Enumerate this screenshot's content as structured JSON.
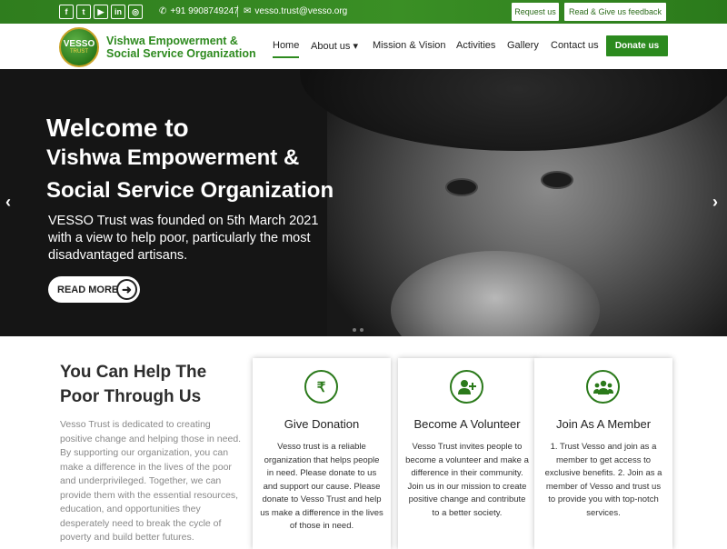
{
  "topbar": {
    "social": [
      "f",
      "t",
      "▶",
      "in",
      "◎"
    ],
    "phone": "+91 9908749247",
    "email": "vesso.trust@vesso.org",
    "request_label": "Request us",
    "feedback_label": "Read & Give us feedback"
  },
  "header": {
    "logo_text": "VESSO",
    "logo_sub": "TRUST",
    "org_line1": "Vishwa Empowerment &",
    "org_line2": "Social Service Organization",
    "nav": [
      "Home",
      "About us ▾",
      "Mission & Vision",
      "Activities",
      "Gallery",
      "Contact us"
    ],
    "donate_label": "Donate us"
  },
  "hero": {
    "title1": "Welcome to",
    "title2": "Vishwa Empowerment &",
    "title3": "Social Service Organization",
    "text1": "VESSO Trust was founded on 5th March 2021",
    "text2": "with a view to help poor, particularly the most",
    "text3": "disadvantaged artisans.",
    "readmore_label": "READ MORE"
  },
  "help": {
    "title1": "You Can Help The",
    "title2": "Poor Through Us",
    "text": "Vesso Trust is dedicated to creating positive change and helping those in need. By supporting our organization, you can make a difference in the lives of the poor and underprivileged. Together, we can provide them with the essential resources, education, and opportunities they desperately need to break the cycle of poverty and build better futures."
  },
  "cards": [
    {
      "icon": "rupee-icon",
      "title": "Give Donation",
      "text": "Vesso trust is a reliable organization that helps people in need. Please donate to us and support our cause. Please donate to Vesso Trust and help us make a difference in the lives of those in need."
    },
    {
      "icon": "add-user-icon",
      "title": "Become A Volunteer",
      "text": "Vesso Trust invites people to become a volunteer and make a difference in their community. Join us in our mission to create positive change and contribute to a better society."
    },
    {
      "icon": "group-icon",
      "title": "Join As A Member",
      "text": "1. Trust Vesso and join as a member to get access to exclusive benefits. 2. Join as a member of Vesso and trust us to provide you with top-notch services."
    }
  ]
}
